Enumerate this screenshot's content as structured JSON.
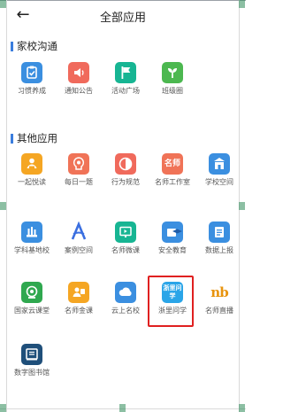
{
  "header": {
    "title": "全部应用",
    "back_icon": "arrow-left-icon"
  },
  "sections": [
    {
      "title": "家校沟通",
      "apps": [
        {
          "label": "习惯养成",
          "icon": "clipboard-check-icon",
          "color": "#3b8fe0"
        },
        {
          "label": "通知公告",
          "icon": "speaker-icon",
          "color": "#f06a5c"
        },
        {
          "label": "活动广场",
          "icon": "flag-icon",
          "color": "#17b593"
        },
        {
          "label": "班级圈",
          "icon": "sprout-icon",
          "color": "#4cb850"
        }
      ]
    },
    {
      "title": "其他应用",
      "apps": [
        {
          "label": "一起悦读",
          "icon": "reader-icon",
          "color": "#f5a623"
        },
        {
          "label": "每日一题",
          "icon": "bulb-head-icon",
          "color": "#f07357"
        },
        {
          "label": "行为规范",
          "icon": "half-circle-icon",
          "color": "#f06a5c"
        },
        {
          "label": "名师工作室",
          "icon": "famous-teacher-icon",
          "color": "#f07357",
          "icon_text": "名师"
        },
        {
          "label": "学校空间",
          "icon": "school-icon",
          "color": "#3b8fe0"
        },
        {
          "label": "学科基地校",
          "icon": "base-icon",
          "color": "#3b8fe0"
        },
        {
          "label": "案例空间",
          "icon": "letter-a-icon",
          "color": "#3b6fe0"
        },
        {
          "label": "名师微课",
          "icon": "screen-play-icon",
          "color": "#17b593"
        },
        {
          "label": "安全教育",
          "icon": "shield-cap-icon",
          "color": "#3b8fe0"
        },
        {
          "label": "数据上报",
          "icon": "report-icon",
          "color": "#3b8fe0"
        },
        {
          "label": "国家云课堂",
          "icon": "cloud-class-icon",
          "color": "#2fa84f"
        },
        {
          "label": "名师金课",
          "icon": "gold-class-icon",
          "color": "#f5a623"
        },
        {
          "label": "云上名校",
          "icon": "cloud-school-icon",
          "color": "#3b8fe0"
        },
        {
          "label": "浙里问学",
          "icon": "zheli-wenxue-icon",
          "color": "#2aa5e8",
          "icon_text": "浙里问学"
        },
        {
          "label": "名师直播",
          "icon": "nb-logo-icon",
          "color": "#e8940e",
          "icon_text": "nb"
        },
        {
          "label": "数字图书馆",
          "icon": "digital-library-icon",
          "color": "#1f4f7a"
        }
      ]
    }
  ]
}
